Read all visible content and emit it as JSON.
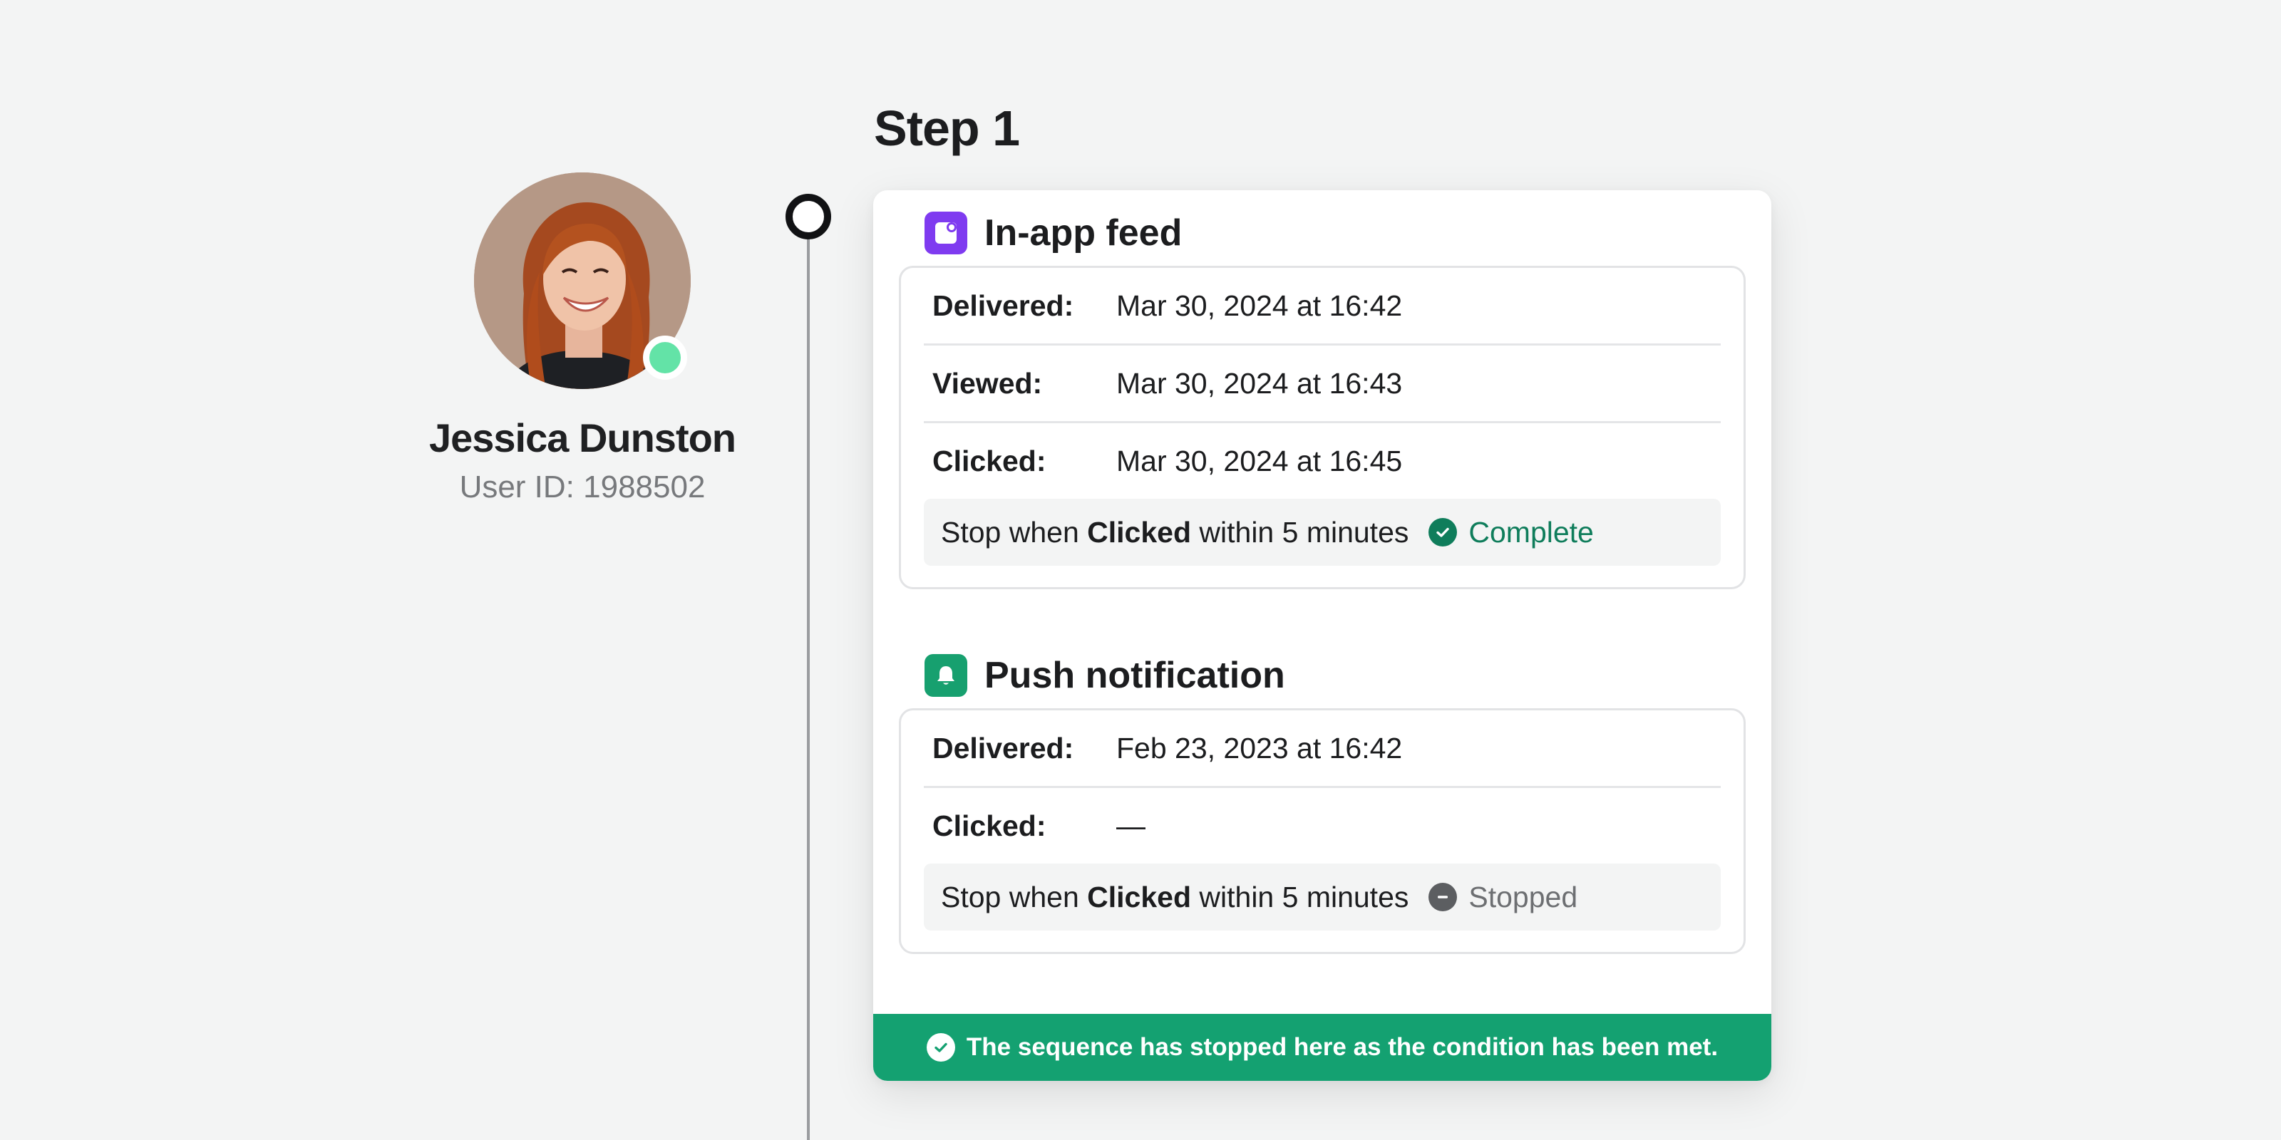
{
  "user": {
    "name": "Jessica Dunston",
    "id_text": "User ID: 1988502",
    "online": true
  },
  "step": {
    "title": "Step 1"
  },
  "channels": [
    {
      "icon": "in-app-feed-icon",
      "icon_color": "#7f3bf0",
      "title": "In-app feed",
      "rows": [
        {
          "label": "Delivered:",
          "value": "Mar 30, 2024 at 16:42"
        },
        {
          "label": "Viewed:",
          "value": "Mar 30, 2024 at 16:43"
        },
        {
          "label": "Clicked:",
          "value": "Mar 30, 2024 at 16:45"
        }
      ],
      "condition": {
        "prefix": "Stop when",
        "event": "Clicked",
        "suffix": "within 5 minutes",
        "status": "Complete",
        "status_icon": "check-circle-icon",
        "status_color": "#0f7d5b"
      }
    },
    {
      "icon": "bell-icon",
      "icon_color": "#17a06f",
      "title": "Push notification",
      "rows": [
        {
          "label": "Delivered:",
          "value": "Feb 23, 2023 at 16:42"
        },
        {
          "label": "Clicked:",
          "value": "—"
        }
      ],
      "condition": {
        "prefix": "Stop when",
        "event": "Clicked",
        "suffix": "within 5 minutes",
        "status": "Stopped",
        "status_icon": "minus-circle-icon",
        "status_color": "#5c5e61"
      }
    }
  ],
  "banner": {
    "text": "The sequence has stopped here as the condition has been met.",
    "icon": "check-circle-icon",
    "color": "#14a171"
  }
}
